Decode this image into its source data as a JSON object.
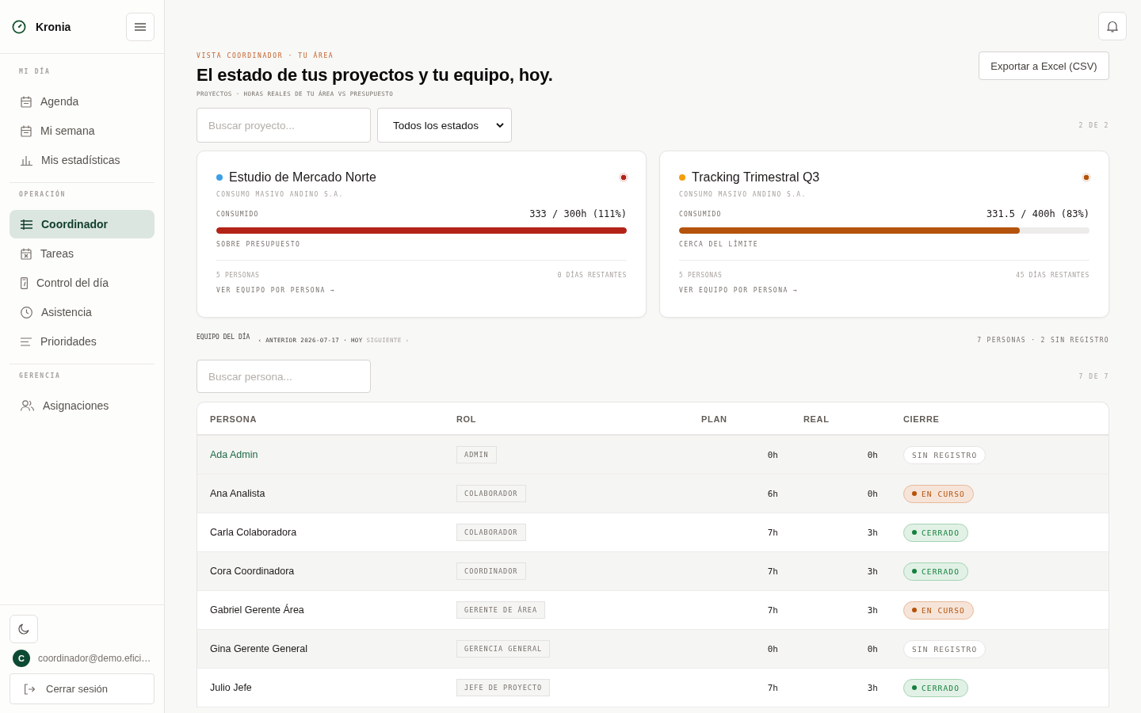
{
  "sidebar": {
    "brand": "Kronia",
    "sections": [
      {
        "title": "MI DÍA",
        "items": [
          {
            "label": "Agenda",
            "selected": false
          },
          {
            "label": "Mi semana",
            "selected": false
          },
          {
            "label": "Mis estadísticas",
            "selected": false
          }
        ]
      },
      {
        "title": "OPERACIÓN",
        "items": [
          {
            "label": "Coordinador",
            "selected": true
          },
          {
            "label": "Tareas",
            "selected": false
          },
          {
            "label": "Control del día",
            "selected": false
          },
          {
            "label": "Asistencia",
            "selected": false
          },
          {
            "label": "Prioridades",
            "selected": false
          }
        ]
      },
      {
        "title": "GERENCIA",
        "items": [
          {
            "label": "Asignaciones",
            "selected": false
          }
        ]
      }
    ],
    "user": {
      "initial": "C",
      "email": "coordinador@demo.efici…"
    },
    "logout": "Cerrar sesión"
  },
  "header": {
    "eyebrow": "VISTA COORDINADOR · TU ÁREA",
    "title": "El estado de tus proyectos y tu equipo, hoy.",
    "subtitle": "PROYECTOS · HORAS REALES DE TU ÁREA VS PRESUPUESTO",
    "export_button": "Exportar a Excel (CSV)"
  },
  "projects": {
    "search": {
      "placeholder": "Buscar proyecto..."
    },
    "status_filter": {
      "value": "Todos los estados"
    },
    "count": "2 DE 2",
    "cards": [
      {
        "title": "Estudio de Mercado Norte",
        "color": "#3b9fe8",
        "client": "CONSUMO MASIVO ANDINO S.A.",
        "consumed_label": "CONSUMIDO",
        "consumed": "333 / 300h (111%)",
        "level": 1,
        "health": {
          "kind": "over",
          "label": "SOBRE PRESUPUESTO"
        },
        "people": "5 PERSONAS",
        "days_left": "0 DÍAS RESTANTES",
        "link": "VER EQUIPO POR PERSONA →"
      },
      {
        "title": "Tracking Trimestral Q3",
        "color": "#f59e0b",
        "client": "CONSUMO MASIVO ANDINO S.A.",
        "consumed_label": "CONSUMIDO",
        "consumed": "331.5 / 400h (83%)",
        "level": 0.83,
        "health": {
          "kind": "near",
          "label": "CERCA DEL LÍMITE"
        },
        "people": "5 PERSONAS",
        "days_left": "45 DÍAS RESTANTES",
        "link": "VER EQUIPO POR PERSONA →"
      }
    ]
  },
  "team": {
    "title": "EQUIPO DEL DÍA",
    "previous": {
      "label": "‹ ANTERIOR",
      "disabled": false
    },
    "date": "2026-07-17 · HOY",
    "next": {
      "label": "SIGUIENTE ›",
      "disabled": true
    },
    "summary": "7 PERSONAS · 2 SIN REGISTRO",
    "search": {
      "placeholder": "Buscar persona..."
    },
    "count": "7 DE 7",
    "table": {
      "columns": [
        "PERSONA",
        "ROL",
        "PLAN",
        "REAL",
        "CIERRE"
      ],
      "rows": [
        {
          "person": "Ada Admin",
          "selected": true,
          "role": "ADMIN",
          "plan": "0h",
          "real": "0h",
          "status": {
            "kind": "none",
            "label": "SIN REGISTRO"
          }
        },
        {
          "person": "Ana Analista",
          "selected": false,
          "role": "COLABORADOR",
          "plan": "6h",
          "real": "0h",
          "status": {
            "kind": "in_progress",
            "label": "EN CURSO"
          }
        },
        {
          "person": "Carla Colaboradora",
          "selected": false,
          "role": "COLABORADOR",
          "plan": "7h",
          "real": "3h",
          "status": {
            "kind": "closed",
            "label": "CERRADO"
          }
        },
        {
          "person": "Cora Coordinadora",
          "selected": false,
          "role": "COORDINADOR",
          "plan": "7h",
          "real": "3h",
          "status": {
            "kind": "closed",
            "label": "CERRADO"
          }
        },
        {
          "person": "Gabriel Gerente Área",
          "selected": false,
          "role": "GERENTE DE ÁREA",
          "plan": "7h",
          "real": "3h",
          "status": {
            "kind": "in_progress",
            "label": "EN CURSO"
          }
        },
        {
          "person": "Gina Gerente General",
          "selected": false,
          "role": "GERENCIA GENERAL",
          "plan": "0h",
          "real": "0h",
          "status": {
            "kind": "none",
            "label": "SIN REGISTRO"
          }
        },
        {
          "person": "Julio Jefe",
          "selected": false,
          "role": "JEFE DE PROYECTO",
          "plan": "7h",
          "real": "3h",
          "status": {
            "kind": "closed",
            "label": "CERRADO"
          }
        }
      ]
    }
  }
}
